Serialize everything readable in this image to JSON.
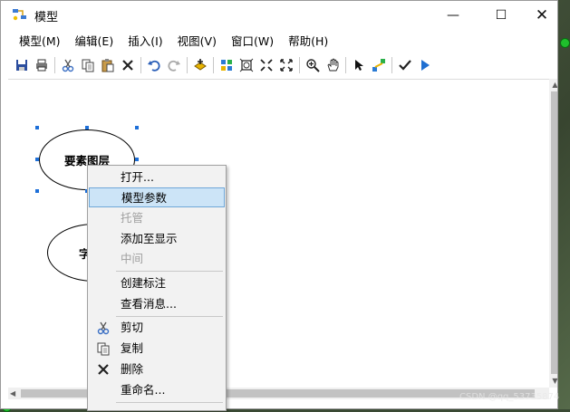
{
  "window": {
    "title": "模型",
    "controls": {
      "minimize": "—",
      "maximize": "☐",
      "close": "✕"
    }
  },
  "menubar": {
    "items": [
      {
        "label": "模型(M)"
      },
      {
        "label": "编辑(E)"
      },
      {
        "label": "插入(I)"
      },
      {
        "label": "视图(V)"
      },
      {
        "label": "窗口(W)"
      },
      {
        "label": "帮助(H)"
      }
    ]
  },
  "toolbar": {
    "icons": [
      "save-icon",
      "print-icon",
      "cut-icon",
      "copy-icon",
      "paste-icon",
      "delete-icon",
      "undo-icon",
      "redo-icon",
      "add-data-icon",
      "auto-layout-icon",
      "full-extent-icon",
      "zoom-in-fixed-icon",
      "zoom-out-fixed-icon",
      "zoom-in-icon",
      "pan-icon",
      "select-icon",
      "connect-icon",
      "validate-icon",
      "run-icon"
    ]
  },
  "canvas": {
    "elements": [
      {
        "label": "要素图层",
        "selected": true
      },
      {
        "label": "字"
      }
    ]
  },
  "context_menu": {
    "items": [
      {
        "label": "打开...",
        "enabled": true
      },
      {
        "label": "模型参数",
        "enabled": true,
        "highlighted": true
      },
      {
        "label": "托管",
        "enabled": false
      },
      {
        "label": "添加至显示",
        "enabled": true
      },
      {
        "label": "中间",
        "enabled": false
      },
      {
        "label": "创建标注",
        "enabled": true
      },
      {
        "label": "查看消息...",
        "enabled": true
      },
      {
        "label": "剪切",
        "enabled": true,
        "icon": "scissors-icon"
      },
      {
        "label": "复制",
        "enabled": true,
        "icon": "copy-icon"
      },
      {
        "label": "删除",
        "enabled": true,
        "icon": "delete-x-icon"
      },
      {
        "label": "重命名...",
        "enabled": true
      }
    ]
  },
  "watermark": "CSDN @qq_53735874"
}
